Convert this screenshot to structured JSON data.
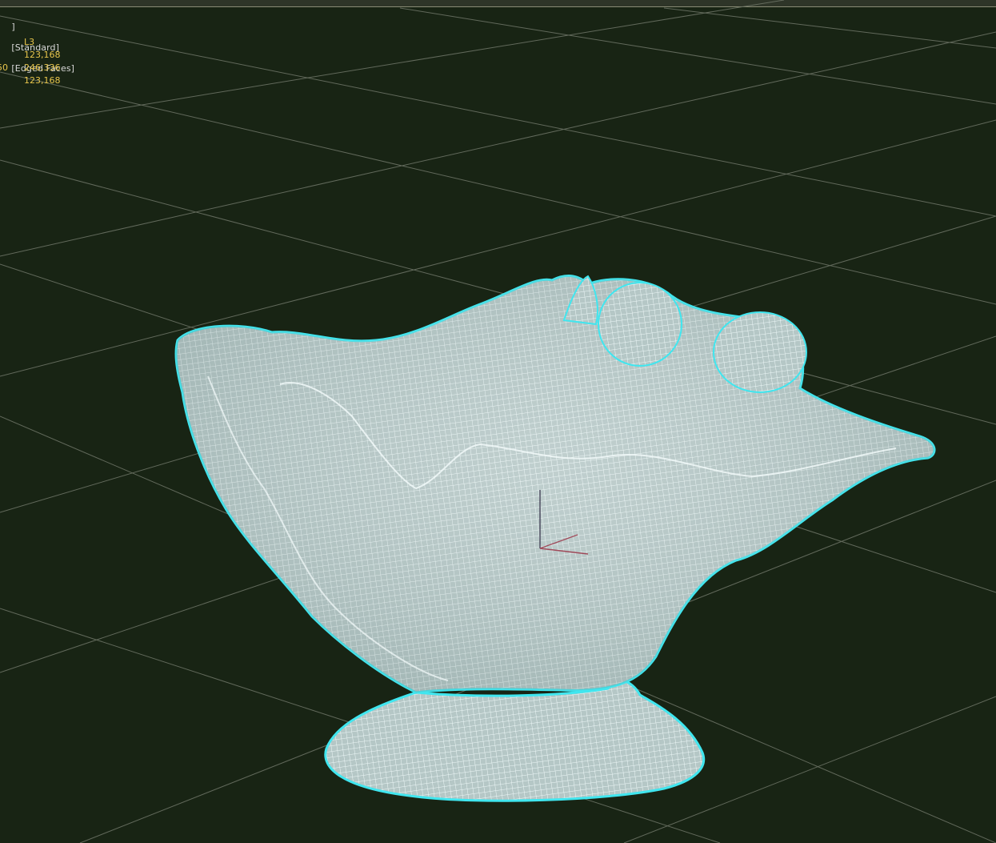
{
  "viewport": {
    "label_prefix": "]",
    "shading_mode": "[Standard]",
    "edge_mode": "[Edged Faces]"
  },
  "stats": {
    "rows": [
      {
        "key": "",
        "value": "L3"
      },
      {
        "key": "",
        "value": "123,168"
      },
      {
        "key": "50",
        "value": "246,336"
      },
      {
        "key": "",
        "value": "123,168"
      }
    ]
  },
  "colors": {
    "background": "#182414",
    "grid": "#6a7163",
    "mesh_fill": "#b9cbc9",
    "mesh_wire": "#e9f5f5",
    "selection_outline": "#40e6ef",
    "stats_text": "#e8c64c",
    "label_text": "#d9d9d9"
  },
  "scene": {
    "object": "shell-bowl-mesh",
    "display": "wireframe-edged-faces",
    "selected": true
  }
}
